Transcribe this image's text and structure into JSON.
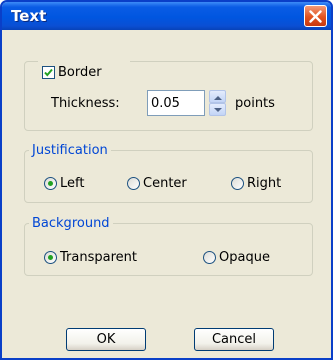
{
  "window": {
    "title": "Text"
  },
  "border": {
    "label": "Border",
    "checked": true
  },
  "thickness": {
    "label": "Thickness:",
    "value": "0.05",
    "unit": "points"
  },
  "justification": {
    "legend": "Justification",
    "options": [
      {
        "label": "Left",
        "selected": true
      },
      {
        "label": "Center",
        "selected": false
      },
      {
        "label": "Right",
        "selected": false
      }
    ]
  },
  "background": {
    "legend": "Background",
    "options": [
      {
        "label": "Transparent",
        "selected": true
      },
      {
        "label": "Opaque",
        "selected": false
      }
    ]
  },
  "buttons": {
    "ok": "OK",
    "cancel": "Cancel"
  },
  "colors": {
    "titlebar": "#0056e0",
    "dialog": "#ece9d8",
    "legend": "#0046d5",
    "radio_dot": "#21a121"
  }
}
